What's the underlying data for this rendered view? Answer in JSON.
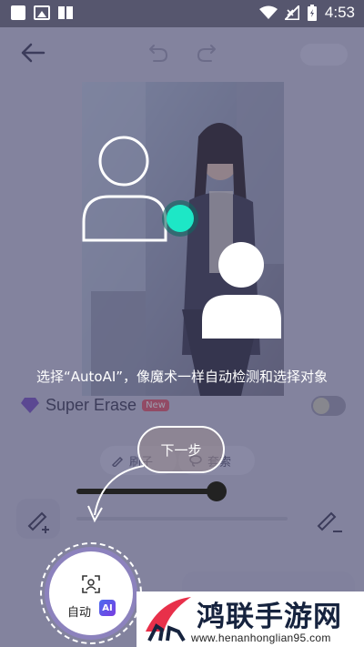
{
  "status_bar": {
    "time": "4:53"
  },
  "app": {
    "super_erase": {
      "label": "Super Erase",
      "badge": "New"
    },
    "tools": {
      "brush_label": "刷子",
      "lasso_label": "套索"
    }
  },
  "tutorial": {
    "text": "选择“AutoAI”，像魔术一样自动检测和选择对象",
    "next_button": "下一步",
    "auto_label": "自动",
    "ai_badge": "AI"
  },
  "watermark": {
    "title": "鸿联手游网",
    "url": "www.henanhonglian95.com"
  },
  "colors": {
    "accent": "#1de7c6",
    "overlay": "#3c3c5c",
    "ai_badge": "#5a55e8"
  }
}
